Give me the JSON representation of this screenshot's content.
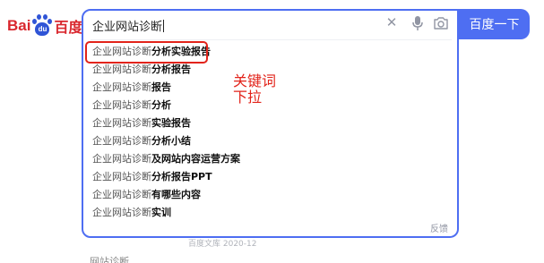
{
  "logo": {
    "latin": "Bai",
    "paw_text": "du",
    "chinese": "百度"
  },
  "search": {
    "query": "企业网站诊断",
    "submit_label": "百度一下"
  },
  "suggestions": [
    {
      "prefix": "企业网站诊断",
      "rest": "分析实验报告"
    },
    {
      "prefix": "企业网站诊断",
      "rest": "分析报告"
    },
    {
      "prefix": "企业网站诊断",
      "rest": "报告"
    },
    {
      "prefix": "企业网站诊断",
      "rest": "分析"
    },
    {
      "prefix": "企业网站诊断",
      "rest": "实验报告"
    },
    {
      "prefix": "企业网站诊断",
      "rest": "分析小结"
    },
    {
      "prefix": "企业网站诊断",
      "rest": "及网站内容运营方案"
    },
    {
      "prefix": "企业网站诊断",
      "rest": "分析报告PPT"
    },
    {
      "prefix": "企业网站诊断",
      "rest": "有哪些内容"
    },
    {
      "prefix": "企业网站诊断",
      "rest": "实训"
    }
  ],
  "annotation": {
    "line1": "关键词",
    "line2": "下拉"
  },
  "feedback_label": "反馈",
  "background": {
    "faded_line": "百度文库 2020-12",
    "partial_title": "网站诊断"
  },
  "colors": {
    "brand_blue": "#4e6ef2",
    "logo_red": "#d9272e",
    "annotation_red": "#e2231a"
  },
  "icons": {
    "clear": "close-icon",
    "voice": "microphone-icon",
    "image_search": "camera-icon"
  }
}
